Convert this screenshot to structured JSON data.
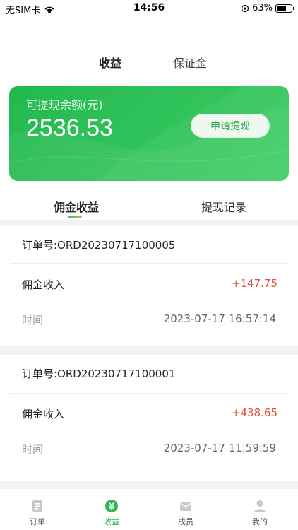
{
  "status_bar": {
    "carrier": "无SIM卡",
    "time": "14:56",
    "battery": "63%",
    "battery_level": 0.63
  },
  "top_tabs": {
    "active": "收益",
    "inactive": "保证金"
  },
  "balance": {
    "label": "可提现余额(元)",
    "value": "2536.53",
    "button": "申请提现"
  },
  "sub_tabs": {
    "active": "佣金收益",
    "inactive": "提现记录"
  },
  "orders": [
    {
      "order_no": "订单号:ORD20230717100005",
      "income_label": "佣金收入",
      "amount": "+147.75",
      "time_label": "时间",
      "time": "2023-07-17 16:57:14"
    },
    {
      "order_no": "订单号:ORD20230717100001",
      "income_label": "佣金收入",
      "amount": "+438.65",
      "time_label": "时间",
      "time": "2023-07-17 11:59:59"
    }
  ],
  "tabbar": {
    "items": [
      {
        "label": "订单",
        "icon": "order-icon"
      },
      {
        "label": "收益",
        "icon": "yen-icon"
      },
      {
        "label": "成员",
        "icon": "members-icon"
      },
      {
        "label": "我的",
        "icon": "profile-icon"
      }
    ],
    "active_index": 1,
    "active_color": "#2fb551"
  },
  "colors": {
    "accent_green": "#2fc25a",
    "amount_red": "#e74c3c"
  }
}
